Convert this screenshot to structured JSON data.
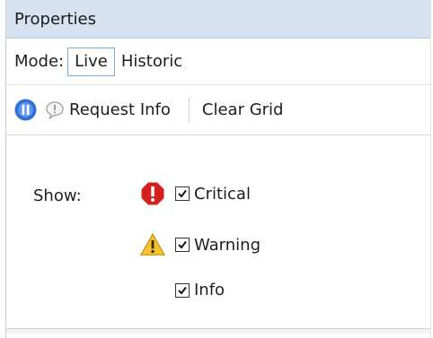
{
  "panel": {
    "title": "Properties"
  },
  "mode": {
    "label": "Mode:",
    "options": [
      "Live",
      "Historic"
    ],
    "selected": "Live"
  },
  "toolbar": {
    "request_info": "Request Info",
    "clear_grid": "Clear Grid"
  },
  "filters": {
    "show_label": "Show:",
    "items": [
      {
        "label": "Critical",
        "checked": true,
        "icon": "error-icon"
      },
      {
        "label": "Warning",
        "checked": true,
        "icon": "warning-icon"
      },
      {
        "label": "Info",
        "checked": true,
        "icon": "none"
      }
    ]
  },
  "colors": {
    "title_bar": "#d6e2f0",
    "accent_blue": "#2f6fd6",
    "error_red": "#d62020",
    "warning_yellow": "#f2c230"
  }
}
